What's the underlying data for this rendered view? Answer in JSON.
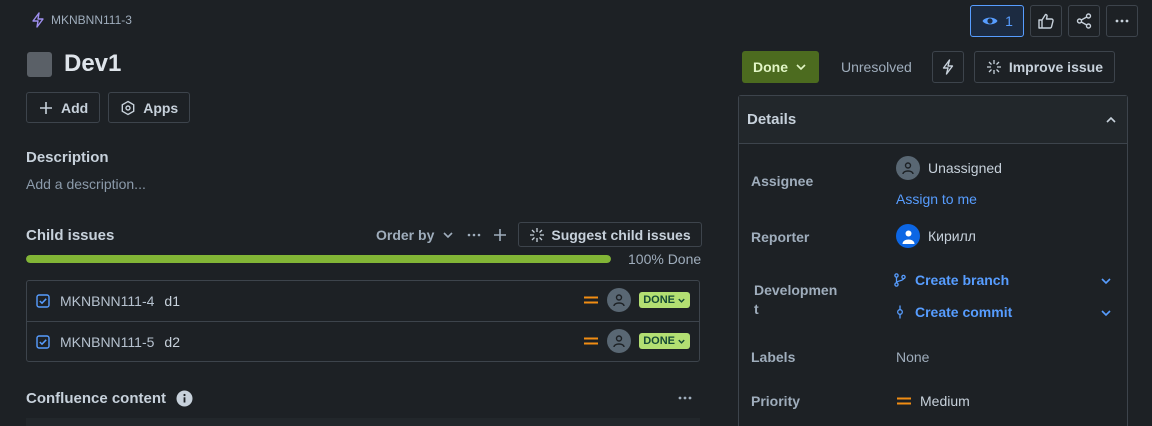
{
  "breadcrumb": {
    "issue_key": "MKNBNN111-3"
  },
  "top_actions": {
    "watch_count": "1"
  },
  "issue": {
    "title": "Dev1"
  },
  "buttons": {
    "add": "Add",
    "apps": "Apps"
  },
  "description": {
    "heading": "Description",
    "placeholder": "Add a description..."
  },
  "child_issues": {
    "heading": "Child issues",
    "order_by": "Order by",
    "suggest": "Suggest child issues",
    "progress_label": "100% Done",
    "progress_fraction": 1.0,
    "items": [
      {
        "key": "MKNBNN111-4",
        "summary": "d1",
        "status": "DONE"
      },
      {
        "key": "MKNBNN111-5",
        "summary": "d2",
        "status": "DONE"
      }
    ]
  },
  "confluence": {
    "heading": "Confluence content"
  },
  "status": {
    "label": "Done",
    "resolution": "Unresolved",
    "improve": "Improve issue"
  },
  "details": {
    "heading": "Details",
    "assignee_label": "Assignee",
    "assignee_value": "Unassigned",
    "assign_to_me": "Assign to me",
    "reporter_label": "Reporter",
    "reporter_value": "Кирилл",
    "development_label_1": "Developmen",
    "development_label_2": "t",
    "create_branch": "Create branch",
    "create_commit": "Create commit",
    "labels_label": "Labels",
    "labels_value": "None",
    "priority_label": "Priority",
    "priority_value": "Medium"
  },
  "colors": {
    "background": "#1d2125",
    "status_done": "#4c6b1f",
    "progress": "#82b536",
    "link": "#579dff",
    "priority_medium": "#f18d13",
    "done_badge": "#b3df72"
  }
}
